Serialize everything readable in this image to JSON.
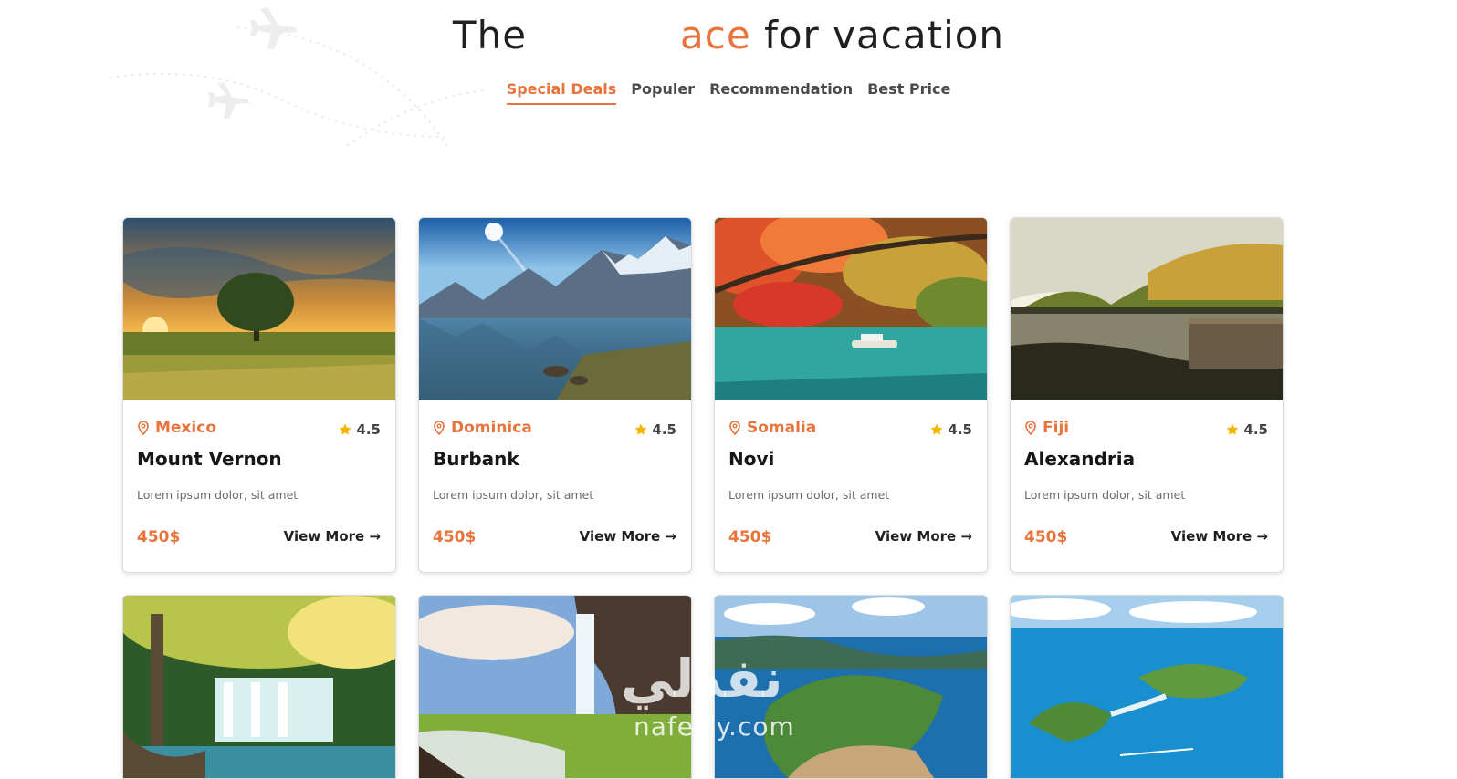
{
  "headline": {
    "part1": "The",
    "accent": "ace",
    "part2": "for vacation"
  },
  "tabs": [
    {
      "label": "Special Deals",
      "active": true
    },
    {
      "label": "Populer",
      "active": false
    },
    {
      "label": "Recommendation",
      "active": false
    },
    {
      "label": "Best Price",
      "active": false
    }
  ],
  "cards": [
    {
      "country": "Mexico",
      "rating": "4.5",
      "title": "Mount Vernon",
      "description": "Lorem ipsum dolor, sit amet",
      "price": "450$",
      "cta": "View More →",
      "image": "sunset-tree-landscape"
    },
    {
      "country": "Dominica",
      "rating": "4.5",
      "title": "Burbank",
      "description": "Lorem ipsum dolor, sit amet",
      "price": "450$",
      "cta": "View More →",
      "image": "mountain-lake"
    },
    {
      "country": "Somalia",
      "rating": "4.5",
      "title": "Novi",
      "description": "Lorem ipsum dolor, sit amet",
      "price": "450$",
      "cta": "View More →",
      "image": "autumn-river-boat"
    },
    {
      "country": "Fiji",
      "rating": "4.5",
      "title": "Alexandria",
      "description": "Lorem ipsum dolor, sit amet",
      "price": "450$",
      "cta": "View More →",
      "image": "forest-lake-dock"
    }
  ],
  "second_row_images": [
    "jungle-waterfall",
    "cave-waterfall",
    "tropical-island",
    "island-sea"
  ],
  "watermark": {
    "arabic": "نفذلي",
    "latin": "nafezly.com"
  },
  "colors": {
    "accent": "#e8743b",
    "text": "#1f1f1f",
    "muted": "#6b6b6b"
  }
}
